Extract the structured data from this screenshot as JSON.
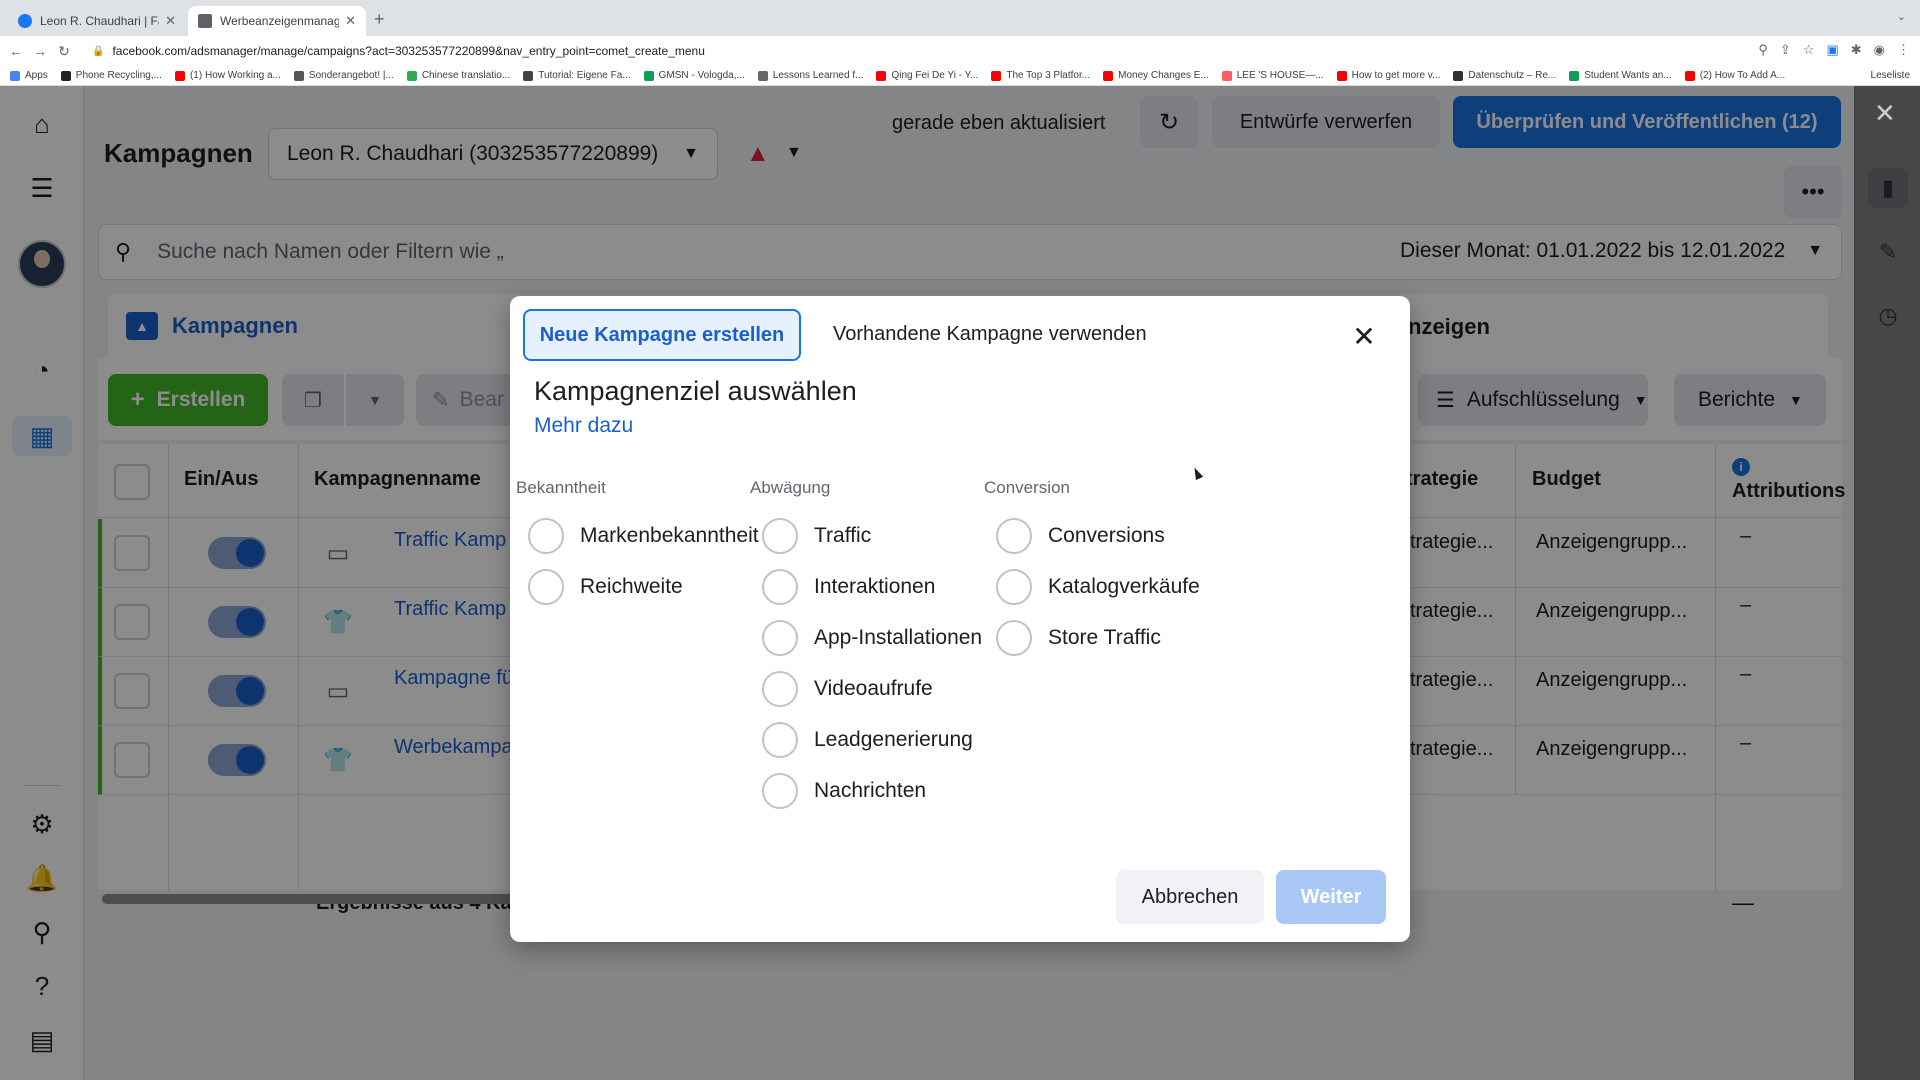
{
  "browser": {
    "tabs": [
      {
        "title": "Leon R. Chaudhari | Facebook",
        "color": "#1877f2"
      },
      {
        "title": "Werbeanzeigenmanager - Wer",
        "color": "#5f6368"
      }
    ],
    "url": "facebook.com/adsmanager/manage/campaigns?act=303253577220899&nav_entry_point=comet_create_menu",
    "bookmarks": [
      {
        "label": "Apps",
        "color": "#4285f4"
      },
      {
        "label": "Phone Recycling,...",
        "color": "#222222"
      },
      {
        "label": "(1) How Working a...",
        "color": "#ff0000"
      },
      {
        "label": "Sonderangebot! |...",
        "color": "#555555"
      },
      {
        "label": "Chinese translatio...",
        "color": "#34a853"
      },
      {
        "label": "Tutorial: Eigene Fa...",
        "color": "#444444"
      },
      {
        "label": "GMSN - Vologda,...",
        "color": "#0f9d58"
      },
      {
        "label": "Lessons Learned f...",
        "color": "#666666"
      },
      {
        "label": "Qing Fei De Yi - Y...",
        "color": "#ff0000"
      },
      {
        "label": "The Top 3 Platfor...",
        "color": "#ff0000"
      },
      {
        "label": "Money Changes E...",
        "color": "#ff0000"
      },
      {
        "label": "LEE 'S HOUSE—...",
        "color": "#ff5a5f"
      },
      {
        "label": "How to get more v...",
        "color": "#ff0000"
      },
      {
        "label": "Datenschutz – Re...",
        "color": "#333333"
      },
      {
        "label": "Student Wants an...",
        "color": "#0f9d58"
      },
      {
        "label": "(2) How To Add A...",
        "color": "#ff0000"
      }
    ],
    "reading_list": "Leseliste"
  },
  "header": {
    "title": "Kampagnen",
    "account": "Leon R. Chaudhari (303253577220899)",
    "updated": "gerade eben aktualisiert",
    "discard": "Entwürfe verwerfen",
    "publish": "Überprüfen und Veröffentlichen (12)"
  },
  "search": {
    "placeholder": "Suche nach Namen oder Filtern wie „",
    "date_range": "Dieser Monat: 01.01.2022 bis 12.01.2022"
  },
  "level_tabs": {
    "campaigns": "Kampagnen",
    "ads": "nzeigen"
  },
  "toolbar": {
    "create": "Erstellen",
    "edit": "Bear",
    "breakdown": "Aufschlüsselung",
    "reports": "Berichte"
  },
  "table": {
    "headers": {
      "onoff": "Ein/Aus",
      "name": "Kampagnenname",
      "strategy": "trategie",
      "budget": "Budget",
      "attribution": "Attributions"
    },
    "rows": [
      {
        "name": "Traffic Kamp",
        "strategy": "trategie...",
        "budget": "Anzeigengrupp...",
        "attribution": "–",
        "thumb": "laptop"
      },
      {
        "name": "Traffic Kamp",
        "strategy": "trategie...",
        "budget": "Anzeigengrupp...",
        "attribution": "–",
        "thumb": "shirt"
      },
      {
        "name": "Kampagne fü",
        "strategy": "trategie...",
        "budget": "Anzeigengrupp...",
        "attribution": "–",
        "thumb": "laptop"
      },
      {
        "name": "Werbekampa",
        "strategy": "trategie...",
        "budget": "Anzeigengrupp...",
        "attribution": "–",
        "thumb": "shirt"
      }
    ],
    "results": "Ergebnisse aus 4 Ka",
    "results_dash": "—"
  },
  "modal": {
    "tab_new": "Neue Kampagne erstellen",
    "tab_existing": "Vorhandene Kampagne verwenden",
    "title": "Kampagnenziel auswählen",
    "learn_more": "Mehr dazu",
    "columns": [
      {
        "heading": "Bekanntheit",
        "options": [
          "Markenbekanntheit",
          "Reichweite"
        ]
      },
      {
        "heading": "Abwägung",
        "options": [
          "Traffic",
          "Interaktionen",
          "App-Installationen",
          "Videoaufrufe",
          "Leadgenerierung",
          "Nachrichten"
        ]
      },
      {
        "heading": "Conversion",
        "options": [
          "Conversions",
          "Katalogverkäufe",
          "Store Traffic"
        ]
      }
    ],
    "cancel": "Abbrechen",
    "next": "Weiter"
  },
  "colors": {
    "brand_blue": "#1b74e4",
    "link_blue": "#1b5fcc",
    "create_green": "#42b72a",
    "warning_red": "#e41e3f",
    "disabled_blue": "#a9c8f5"
  }
}
